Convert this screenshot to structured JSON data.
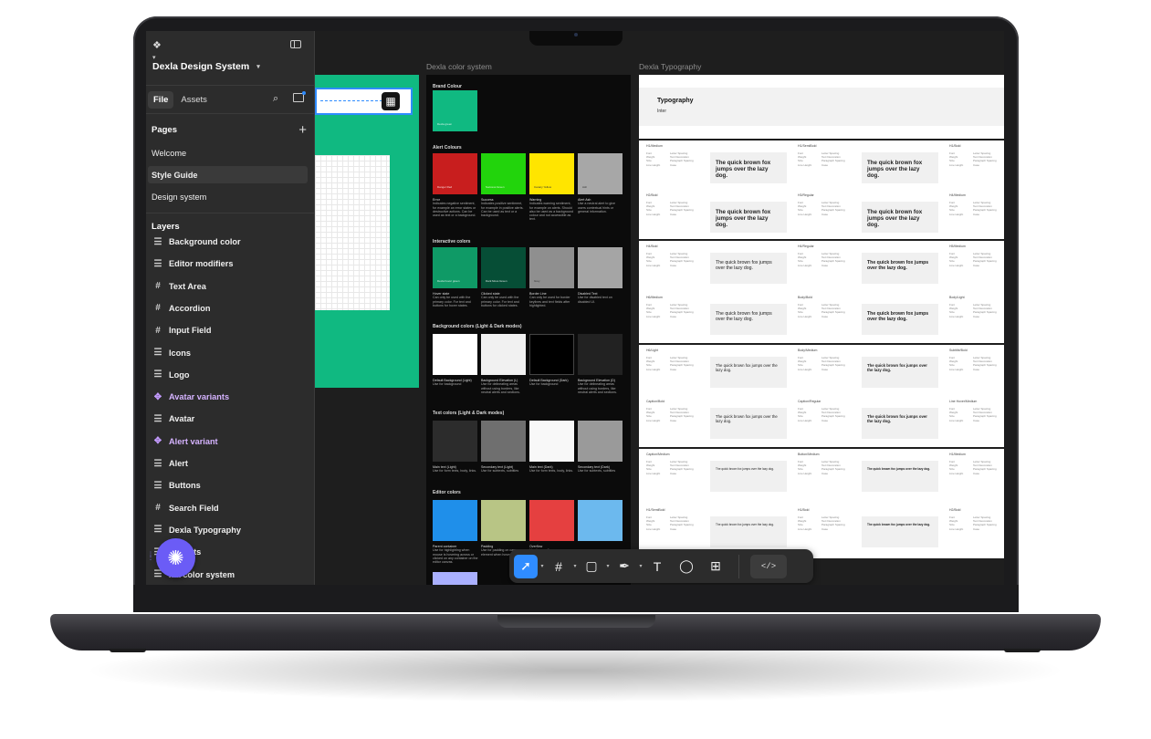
{
  "app": {
    "project_name": "Dexla Design System"
  },
  "sidebar": {
    "tabs": [
      {
        "label": "File"
      },
      {
        "label": "Assets"
      }
    ],
    "pages_title": "Pages",
    "pages": [
      {
        "label": "Welcome"
      },
      {
        "label": "Style Guide"
      },
      {
        "label": "Design system"
      }
    ],
    "active_page": "Style Guide",
    "layers_title": "Layers",
    "layers": [
      {
        "label": "Background color",
        "icon": "frame-list-icon"
      },
      {
        "label": "Editor modifiers",
        "icon": "frame-list-icon"
      },
      {
        "label": "Text Area",
        "icon": "frame-hash-icon"
      },
      {
        "label": "Accordion",
        "icon": "frame-hash-icon"
      },
      {
        "label": "Input Field",
        "icon": "frame-hash-icon"
      },
      {
        "label": "Icons",
        "icon": "frame-list-icon"
      },
      {
        "label": "Logo",
        "icon": "frame-list-icon"
      },
      {
        "label": "Avatar variants",
        "icon": "component-icon"
      },
      {
        "label": "Avatar",
        "icon": "frame-list-icon"
      },
      {
        "label": "Alert variant",
        "icon": "component-icon"
      },
      {
        "label": "Alert",
        "icon": "frame-list-icon"
      },
      {
        "label": "Buttons",
        "icon": "frame-list-icon"
      },
      {
        "label": "Search Field",
        "icon": "frame-hash-icon"
      },
      {
        "label": "Dexla Typography",
        "icon": "frame-list-icon"
      },
      {
        "label": "variants",
        "icon": "frame-list-icon"
      },
      {
        "label": "xla color system",
        "icon": "frame-list-icon"
      }
    ]
  },
  "canvas": {
    "color_frame_label": "Dexla color system",
    "typography_frame_label": "Dexla Typography",
    "color_system": {
      "brand_title": "Brand Colour",
      "brand_swatch": {
        "color": "#10b981",
        "name": "Dexla green"
      },
      "alert_title": "Alert Colours",
      "alert": [
        {
          "color": "#c81e1e",
          "name": "Danger Red",
          "cap_title": "Error",
          "cap": "Indicates negative sentiment, for example an error states or destructive actions. Can be used as text or a background."
        },
        {
          "color": "#22d40c",
          "name": "Success Green",
          "cap_title": "Success",
          "cap": "Indicates positive sentiment, for example in positive alerts. Can be used as text or a background."
        },
        {
          "color": "#ffe500",
          "name": "Canary Yellow",
          "cap_title": "Warning",
          "cap": "Indicates warning sentiment, for example on alerts. Should also be used as a background colour and not accessible as text."
        },
        {
          "color": "#a7a7a7",
          "name": "Ash",
          "cap_title": "Alert Ash",
          "cap": "Use a neutral alert to give users contextual hints or general information."
        }
      ],
      "interactive_title": "Interactive colors",
      "interactive": [
        {
          "color": "#0f9a66",
          "name": "Dexla hover green",
          "cap_title": "Hover state",
          "cap": "Can only be used with the primary color. For text and buttons for hover states."
        },
        {
          "color": "#064e36",
          "name": "Dark Moss Green",
          "cap_title": "Clicked state",
          "cap": "Can only be used with the primary color. For text and buttons for clicked states."
        },
        {
          "color": "#8f8f8f",
          "name": "Grey",
          "cap_title": "Border Line",
          "cap": "Can only be used for border keylines and text fields after highlighted."
        },
        {
          "color": "#a5a5a5",
          "name": "",
          "cap_title": "Disabled Text",
          "cap": "Use for disabled text on disabled UI."
        }
      ],
      "background_title": "Background colors (Light & Dark modes)",
      "background": [
        {
          "color": "#ffffff",
          "name": "",
          "cap_title": "Default Background (Light)",
          "cap": "Use for background"
        },
        {
          "color": "#f1f1f1",
          "name": "",
          "cap_title": "Background Elevation (L)",
          "cap": "Use for delineating areas without using borders, like neutral alerts and sections."
        },
        {
          "color": "#000000",
          "name": "",
          "cap_title": "Default Background (Dark)",
          "cap": "Use for background"
        },
        {
          "color": "#222222",
          "name": "",
          "cap_title": "Background Elevation (D)",
          "cap": "Use for delineating areas without using borders, like neutral alerts and sections."
        }
      ],
      "text_title": "Text colors (Light & Dark modes)",
      "text": [
        {
          "color": "#2c2c2c",
          "name": "",
          "cap_title": "Main text (Light)",
          "cap": "Use for form texts, body, links."
        },
        {
          "color": "#6f6f6f",
          "name": "",
          "cap_title": "Secondary text (Light)",
          "cap": "Use for subtexts, subtitles"
        },
        {
          "color": "#f8f8f8",
          "name": "",
          "cap_title": "Main text (Dark)",
          "cap": "Use for form texts, body, links."
        },
        {
          "color": "#9a9a9a",
          "name": "",
          "cap_title": "Secondary text (Dark)",
          "cap": "Use for subtexts, subtitles"
        }
      ],
      "editor_title": "Editor colors",
      "editor": [
        {
          "color": "#1f8fea",
          "name": "",
          "cap_title": "Parent container",
          "cap": "Use for highlighting when mouse is hovering across or clicked on any container on the editor canvas."
        },
        {
          "color": "#b8c585",
          "name": "",
          "cap_title": "Padding",
          "cap": "Use for padding on canvas element when hovered."
        },
        {
          "color": "#e54040",
          "name": "",
          "cap_title": "Overflow",
          "cap": "Use for overflow."
        },
        {
          "color": "#6cb9ee",
          "name": "",
          "cap_title": "",
          "cap": ""
        }
      ],
      "extra_swatch": "#aab0ff"
    },
    "typography": {
      "title": "Typography",
      "font": "Inter",
      "pangram": "The quick brown fox jumps over the lazy dog.",
      "styles": [
        "H1/Medium",
        "H1/SemiBold",
        "H1/Bold",
        "H2/Bold",
        "H3/Regular",
        "H4/Medium",
        "H4/Bold",
        "H4/Regular",
        "H5/Medium",
        "H6/Medium",
        "Body/Bold",
        "Body/Light",
        "H6/Light",
        "Body/Medium",
        "Subtitle/Bold",
        "Caption/Bold",
        "Caption/Regular",
        "Line Hover/Medium",
        "Caption/Medium",
        "Button/Medium"
      ],
      "meta_labels": [
        "Font",
        "Weight",
        "Size",
        "Line Height",
        "Letter Spacing",
        "Text Decoration",
        "Paragraph Spacing",
        "Case"
      ]
    }
  },
  "toolbar": {
    "tools": [
      {
        "name": "move-tool",
        "glyph": "➚",
        "active": true
      },
      {
        "name": "frame-tool",
        "glyph": "#"
      },
      {
        "name": "shape-tool",
        "glyph": "▢"
      },
      {
        "name": "pen-tool",
        "glyph": "✒"
      },
      {
        "name": "text-tool",
        "glyph": "T"
      },
      {
        "name": "comment-tool",
        "glyph": "◯"
      },
      {
        "name": "resources-tool",
        "glyph": "⊞"
      }
    ],
    "dev_mode_label": "</>"
  },
  "colors": {
    "accent": "#2f8cff",
    "brand": "#10b981",
    "component": "#c49bff",
    "fab": "#6b5cf6"
  }
}
